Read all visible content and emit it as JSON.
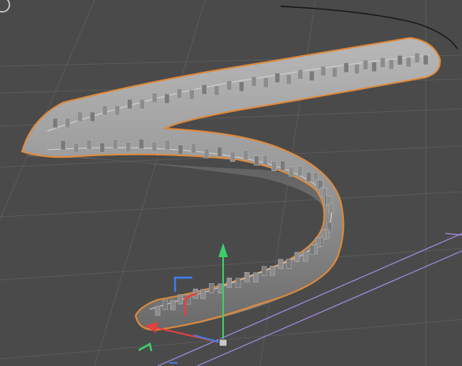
{
  "viewport": {
    "background_color": "#4a4a4a",
    "grid_color": "#5a5a5a",
    "selection_outline_color": "#e08a3a",
    "object_surface_color": "#9a9a9a",
    "spline_color": "#151515",
    "bounds_box_color": "#a58ce6"
  },
  "gizmo": {
    "x_axis_color": "#e64040",
    "y_axis_color": "#3ccf6a",
    "z_axis_color": "#3f7ee8"
  },
  "icons": {
    "corner": "circle-icon"
  }
}
